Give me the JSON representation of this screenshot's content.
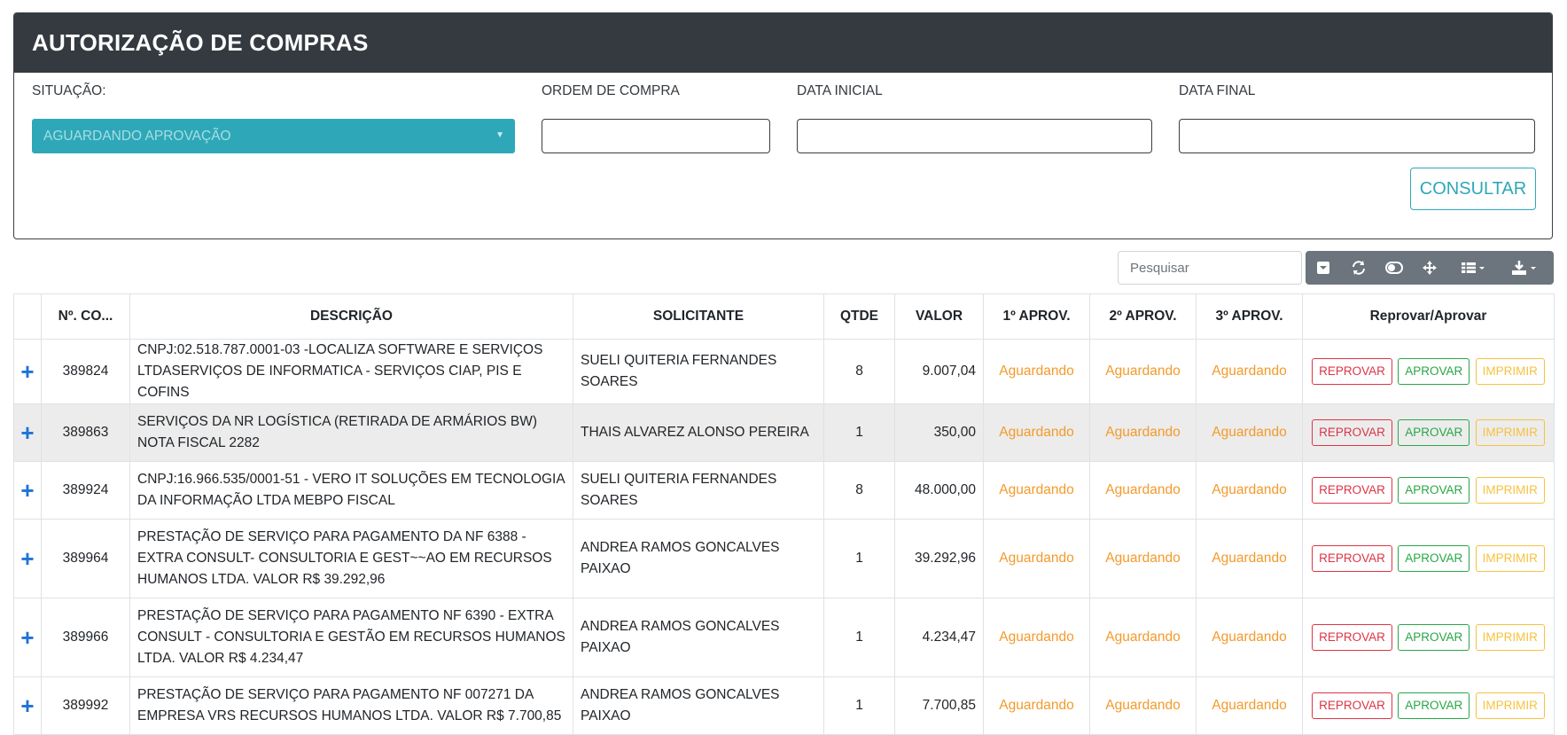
{
  "header": {
    "title": "AUTORIZAÇÃO DE COMPRAS"
  },
  "filters": {
    "situacao_label": "SITUAÇÃO:",
    "situacao_value": "AGUARDANDO APROVAÇÃO",
    "ordem_label": "ORDEM DE COMPRA",
    "data_inicial_label": "DATA INICIAL",
    "data_final_label": "DATA FINAL",
    "consultar_label": "CONSULTAR"
  },
  "search": {
    "placeholder": "Pesquisar"
  },
  "toolbar": [
    "collapse-icon",
    "refresh-icon",
    "toggle-icon",
    "move-icon",
    "columns-icon",
    "export-icon"
  ],
  "table": {
    "headers": [
      "",
      "Nº. CO...",
      "DESCRIÇÃO",
      "SOLICITANTE",
      "QTDE",
      "VALOR",
      "1º APROV.",
      "2º APROV.",
      "3º APROV.",
      "Reprovar/Aprovar"
    ],
    "rows": [
      {
        "expand": "+",
        "numero": "389824",
        "descricao": "CNPJ:02.518.787.0001-03 -LOCALIZA SOFTWARE E SERVIÇOS LTDASERVIÇOS DE INFORMATICA - SERVIÇOS CIAP, PIS E COFINS",
        "solicitante": "SUELI QUITERIA FERNANDES SOARES",
        "qtde": "8",
        "valor": "9.007,04",
        "aprov1": "Aguardando",
        "aprov2": "Aguardando",
        "aprov3": "Aguardando"
      },
      {
        "expand": "+",
        "numero": "389863",
        "descricao": "SERVIÇOS DA NR LOGÍSTICA (RETIRADA DE ARMÁRIOS BW) NOTA FISCAL 2282",
        "solicitante": "THAIS ALVAREZ ALONSO PEREIRA",
        "qtde": "1",
        "valor": "350,00",
        "aprov1": "Aguardando",
        "aprov2": "Aguardando",
        "aprov3": "Aguardando"
      },
      {
        "expand": "+",
        "numero": "389924",
        "descricao": "CNPJ:16.966.535/0001-51 - VERO IT SOLUÇÕES EM TECNOLOGIA DA INFORMAÇÃO LTDA MEBPO FISCAL",
        "solicitante": "SUELI QUITERIA FERNANDES SOARES",
        "qtde": "8",
        "valor": "48.000,00",
        "aprov1": "Aguardando",
        "aprov2": "Aguardando",
        "aprov3": "Aguardando"
      },
      {
        "expand": "+",
        "numero": "389964",
        "descricao": "PRESTAÇÃO DE SERVIÇO PARA PAGAMENTO DA NF 6388 - EXTRA CONSULT- CONSULTORIA E GEST~~AO EM RECURSOS HUMANOS LTDA. VALOR R$ 39.292,96",
        "solicitante": "ANDREA RAMOS GONCALVES PAIXAO",
        "qtde": "1",
        "valor": "39.292,96",
        "aprov1": "Aguardando",
        "aprov2": "Aguardando",
        "aprov3": "Aguardando"
      },
      {
        "expand": "+",
        "numero": "389966",
        "descricao": "PRESTAÇÃO DE SERVIÇO PARA PAGAMENTO NF 6390 - EXTRA CONSULT - CONSULTORIA E GESTÃO EM RECURSOS HUMANOS LTDA. VALOR R$ 4.234,47",
        "solicitante": "ANDREA RAMOS GONCALVES PAIXAO",
        "qtde": "1",
        "valor": "4.234,47",
        "aprov1": "Aguardando",
        "aprov2": "Aguardando",
        "aprov3": "Aguardando"
      },
      {
        "expand": "+",
        "numero": "389992",
        "descricao": "PRESTAÇÃO DE SERVIÇO PARA PAGAMENTO NF 007271 DA EMPRESA VRS RECURSOS HUMANOS LTDA. VALOR R$ 7.700,85",
        "solicitante": "ANDREA RAMOS GONCALVES PAIXAO",
        "qtde": "1",
        "valor": "7.700,85",
        "aprov1": "Aguardando",
        "aprov2": "Aguardando",
        "aprov3": "Aguardando"
      }
    ],
    "actions": {
      "reprovar": "REPROVAR",
      "aprovar": "APROVAR",
      "imprimir": "IMPRIMIR"
    }
  },
  "colors": {
    "header_bg": "#343a40",
    "accent": "#2ea8b8",
    "status": "#f39a2b",
    "danger": "#dc3545",
    "success": "#28a745",
    "warning": "#f6c23e"
  }
}
